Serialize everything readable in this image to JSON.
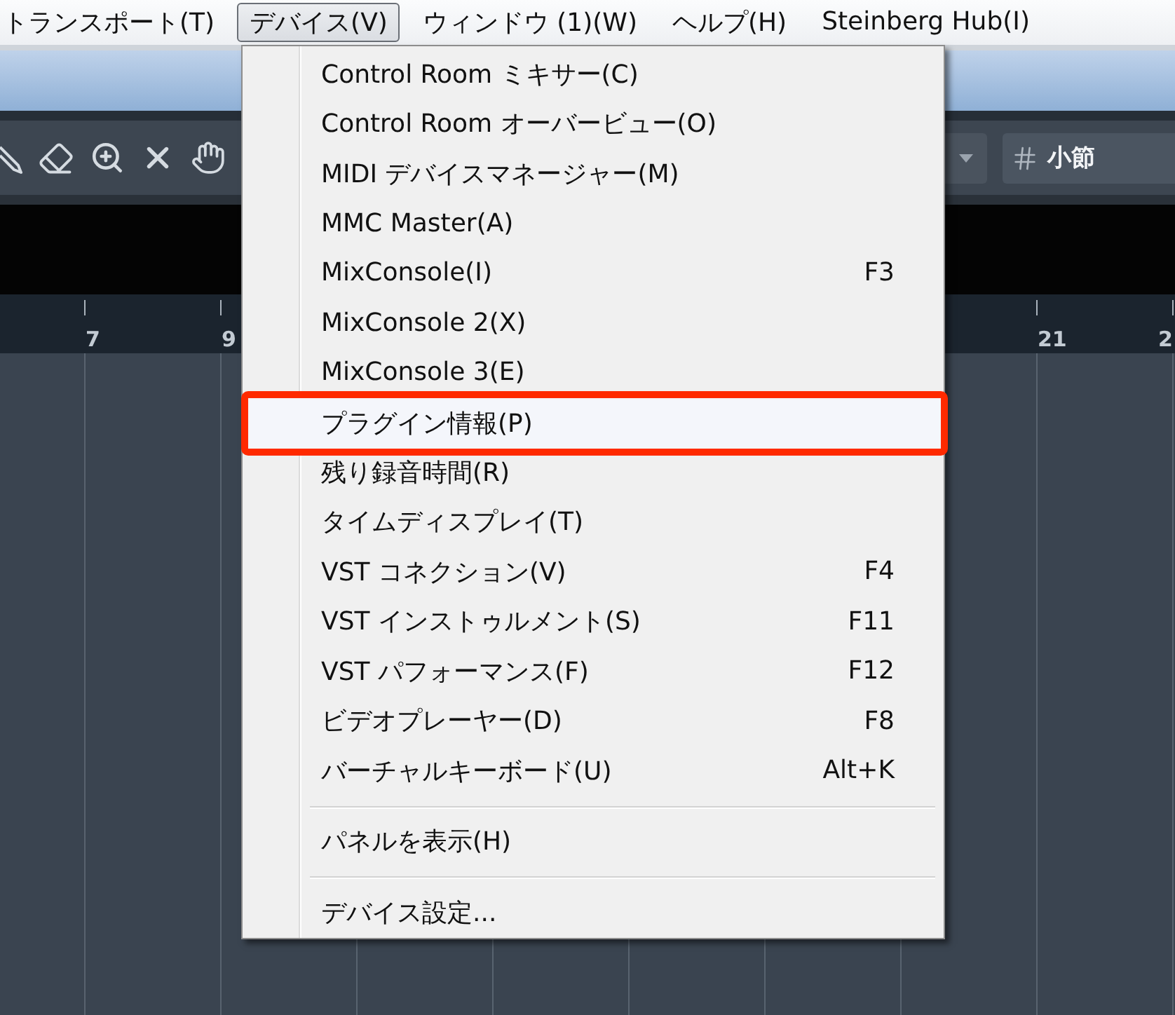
{
  "menu_bar": {
    "items": [
      {
        "label": "トランスポート(T)",
        "selected": false
      },
      {
        "label": "デバイス(V)",
        "selected": true
      },
      {
        "label": "ウィンドウ (1)(W)",
        "selected": false
      },
      {
        "label": "ヘルプ(H)",
        "selected": false
      },
      {
        "label": "Steinberg Hub(I)",
        "selected": false
      }
    ]
  },
  "toolbar": {
    "time_format": {
      "value": "小節"
    }
  },
  "ruler": {
    "left_marks": [
      "7",
      "9"
    ],
    "right_marks": [
      "21",
      "2"
    ]
  },
  "dropdown_menu": {
    "items": [
      {
        "kind": "item",
        "label": "Control Room ミキサー(C)",
        "selected": false,
        "framed": false
      },
      {
        "kind": "item",
        "label": "Control Room オーバービュー(O)",
        "selected": false,
        "framed": false
      },
      {
        "kind": "item",
        "label": "MIDI デバイスマネージャー(M)",
        "selected": false,
        "framed": false
      },
      {
        "kind": "item",
        "label": "MMC Master(A)",
        "selected": false,
        "framed": false
      },
      {
        "kind": "item",
        "label": "MixConsole(I)",
        "shortcut": "F3",
        "selected": false,
        "framed": false
      },
      {
        "kind": "item",
        "label": "MixConsole 2(X)",
        "selected": false,
        "framed": false
      },
      {
        "kind": "item",
        "label": "MixConsole 3(E)",
        "selected": false,
        "framed": false
      },
      {
        "kind": "item",
        "label": "プラグイン情報(P)",
        "selected": true,
        "framed": true
      },
      {
        "kind": "item",
        "label": "残り録音時間(R)",
        "selected": false,
        "framed": false
      },
      {
        "kind": "item",
        "label": "タイムディスプレイ(T)",
        "selected": false,
        "framed": false
      },
      {
        "kind": "item",
        "label": "VST コネクション(V)",
        "shortcut": "F4",
        "selected": false,
        "framed": false
      },
      {
        "kind": "item",
        "label": "VST インストゥルメント(S)",
        "shortcut": "F11",
        "selected": false,
        "framed": false
      },
      {
        "kind": "item",
        "label": "VST パフォーマンス(F)",
        "shortcut": "F12",
        "selected": false,
        "framed": false
      },
      {
        "kind": "item",
        "label": "ビデオプレーヤー(D)",
        "shortcut": "F8",
        "selected": false,
        "framed": false
      },
      {
        "kind": "item",
        "label": "バーチャルキーボード(U)",
        "shortcut": "Alt+K",
        "selected": false,
        "framed": false
      },
      {
        "kind": "separator"
      },
      {
        "kind": "item",
        "label": "パネルを表示(H)",
        "selected": false,
        "framed": false
      },
      {
        "kind": "separator"
      },
      {
        "kind": "item",
        "label": "デバイス設定...",
        "selected": false,
        "framed": false
      }
    ]
  }
}
